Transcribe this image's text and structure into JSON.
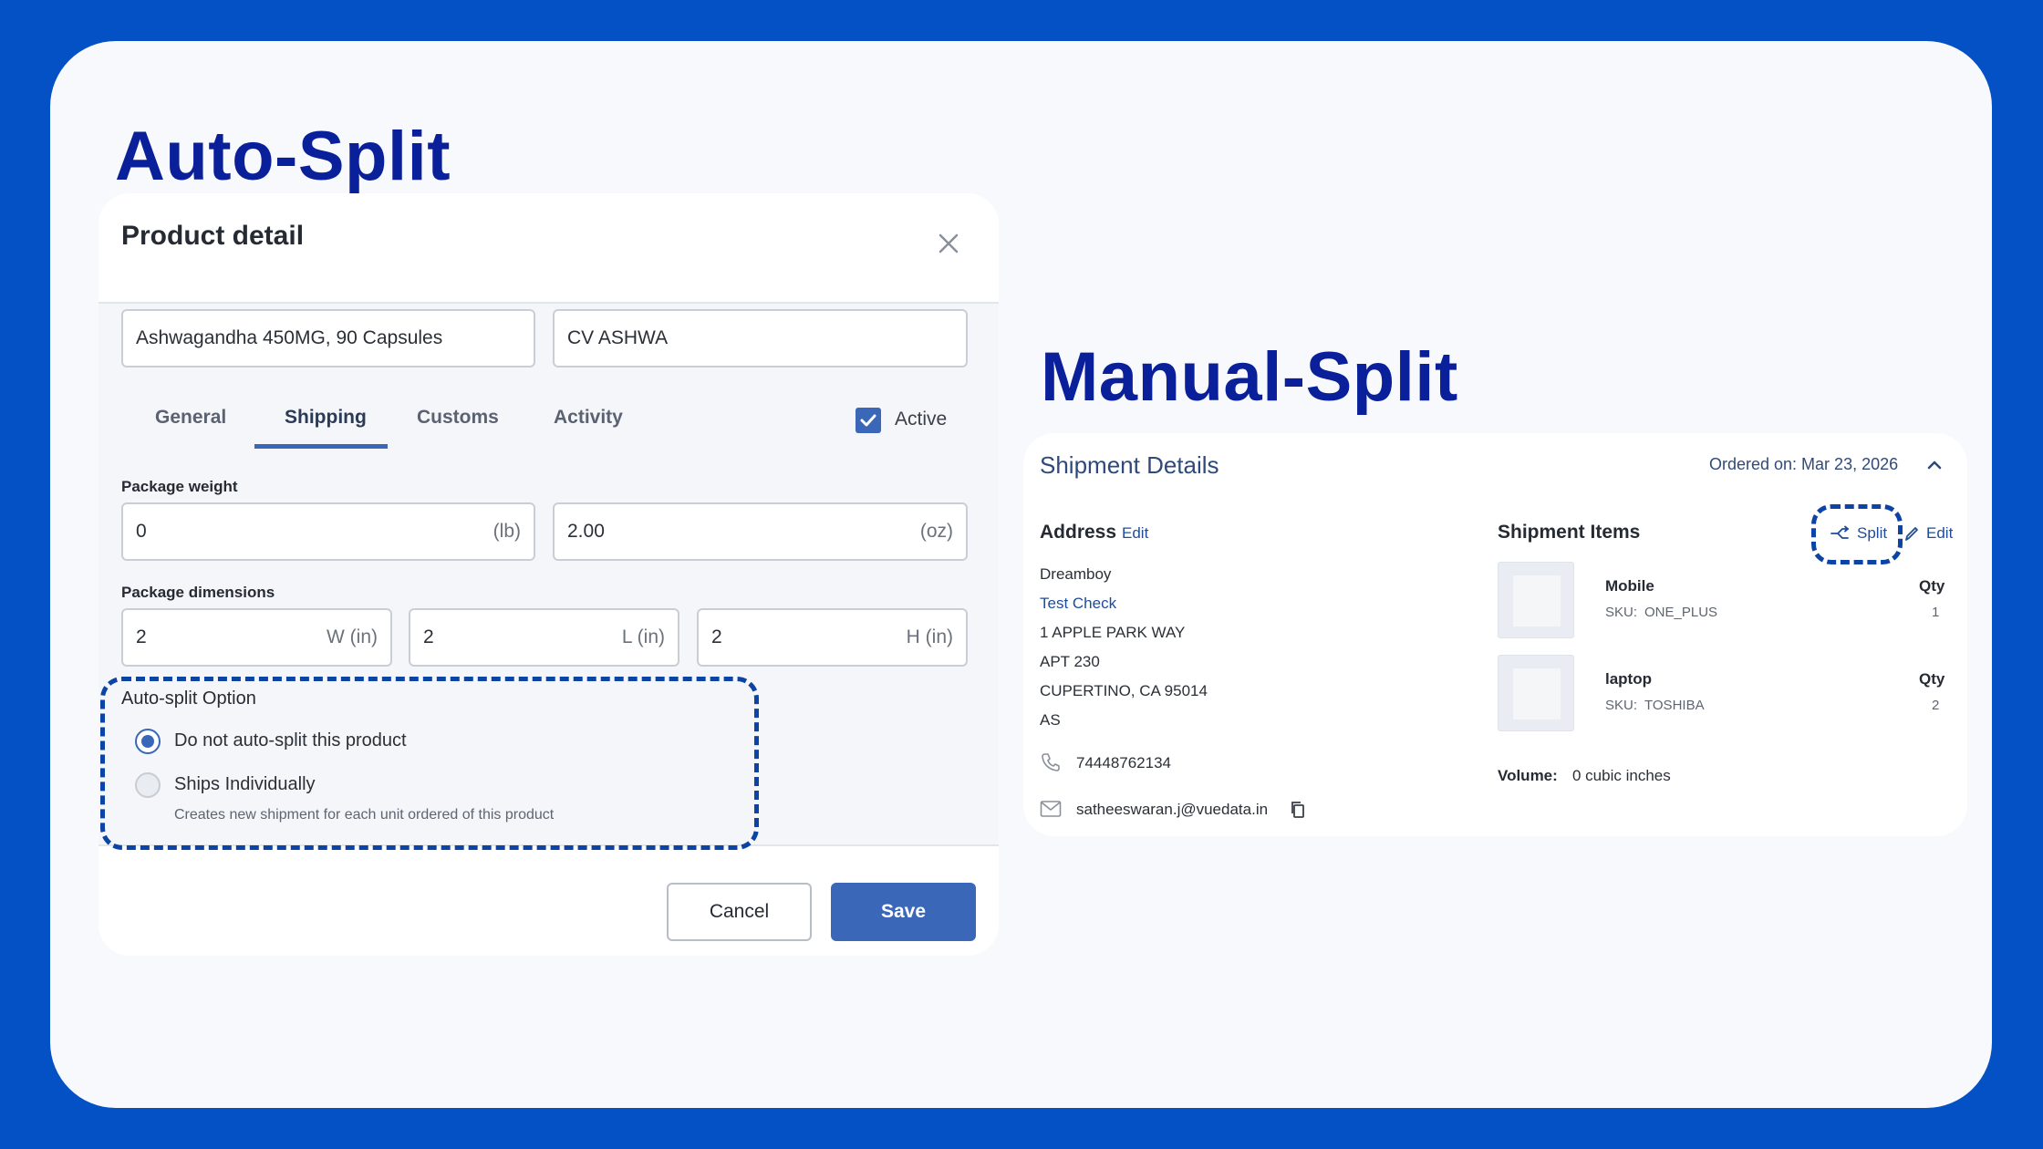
{
  "headings": {
    "auto": "Auto-Split",
    "manual": "Manual-Split"
  },
  "product_modal": {
    "title": "Product detail",
    "name_value": "Ashwagandha 450MG, 90 Capsules",
    "sku_value": "CV ASHWA",
    "tabs": [
      {
        "label": "General"
      },
      {
        "label": "Shipping"
      },
      {
        "label": "Customs"
      },
      {
        "label": "Activity"
      }
    ],
    "active_tab": "Shipping",
    "active_label": "Active",
    "active_checked": true,
    "weight_label": "Package weight",
    "weight_lb_value": "0",
    "weight_lb_unit": "(lb)",
    "weight_oz_value": "2.00",
    "weight_oz_unit": "(oz)",
    "dimensions_label": "Package dimensions",
    "dim_w_value": "2",
    "dim_w_unit": "W (in)",
    "dim_l_value": "2",
    "dim_l_unit": "L (in)",
    "dim_h_value": "2",
    "dim_h_unit": "H (in)",
    "autosplit_label": "Auto-split Option",
    "option1": "Do not auto-split this product",
    "option2": "Ships Individually",
    "option2_sub": "Creates new shipment for each unit ordered of this product",
    "selected_option": "Do not auto-split this product",
    "cancel_label": "Cancel",
    "save_label": "Save"
  },
  "shipment": {
    "title": "Shipment Details",
    "ordered": "Ordered on: Mar 23, 2026",
    "address_heading": "Address",
    "address_edit": "Edit",
    "address_lines": [
      "Dreamboy",
      "Test Check",
      "1 APPLE PARK WAY",
      "APT 230",
      "CUPERTINO, CA 95014",
      "AS"
    ],
    "phone": "74448762134",
    "email": "satheeswaran.j@vuedata.in",
    "items_heading": "Shipment Items",
    "split_label": "Split",
    "items_edit": "Edit",
    "items": [
      {
        "name": "Mobile",
        "sku_label": "SKU:",
        "sku": "ONE_PLUS",
        "qty_label": "Qty",
        "qty": "1"
      },
      {
        "name": "laptop",
        "sku_label": "SKU:",
        "sku": "TOSHIBA",
        "qty_label": "Qty",
        "qty": "2"
      }
    ],
    "volume_label": "Volume:",
    "volume_value": "0 cubic inches"
  },
  "colors": {
    "background": "#0450c5",
    "accent": "#3a67b8",
    "title": "#0a1f9a",
    "highlight": "#0b44a5"
  }
}
